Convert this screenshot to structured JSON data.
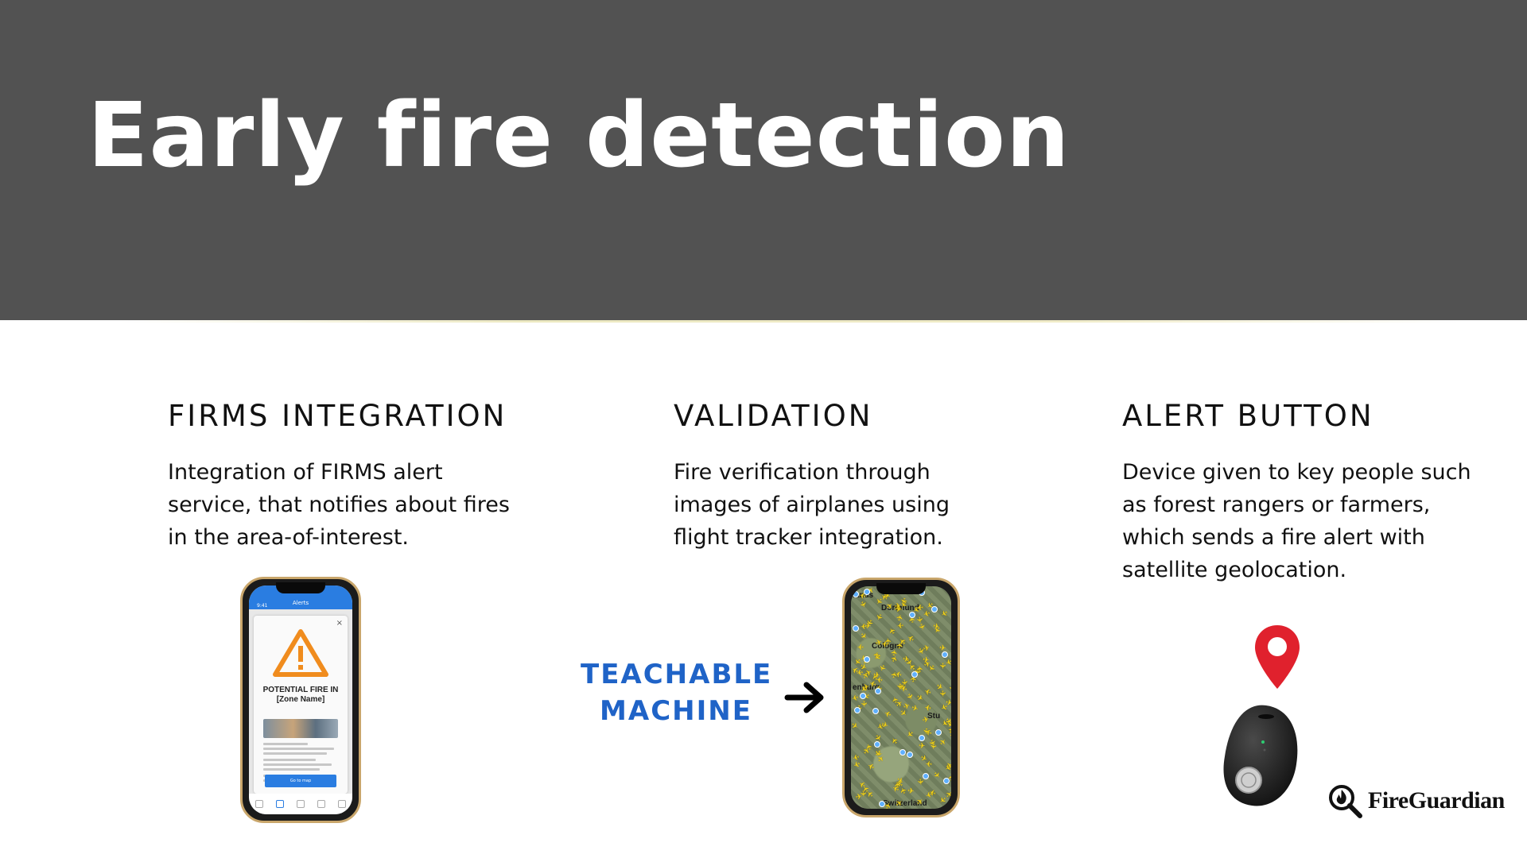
{
  "slide": {
    "title": "Early fire detection"
  },
  "columns": [
    {
      "heading": "FIRMS INTEGRATION",
      "lines": [
        "Integration of FIRMS alert",
        "service, that notifies about fires",
        "in the area-of-interest."
      ]
    },
    {
      "heading": "VALIDATION",
      "lines": [
        "Fire verification through",
        "images of airplanes using",
        "flight tracker integration."
      ]
    },
    {
      "heading": "ALERT BUTTON",
      "lines": [
        "Device given to key people such",
        "as forest rangers or farmers,",
        "which sends a fire alert with",
        "satellite geolocation."
      ]
    }
  ],
  "phone_app": {
    "time": "9:41",
    "bar_title": "Alerts",
    "close_glyph": "×",
    "modal_title_line1": "POTENTIAL FIRE IN",
    "modal_title_line2": "[Zone Name]",
    "button_label": "Go to map"
  },
  "phone_map": {
    "labels": [
      "lands",
      "Dortmund",
      "Cologne",
      "enburg",
      "Stu",
      "Switzerland"
    ]
  },
  "teachable": {
    "line1": "TEACHABLE",
    "line2": "MACHINE"
  },
  "logo": {
    "text": "FireGuardian"
  },
  "colors": {
    "header_bg": "#525252",
    "accent_blue": "#1f63c7",
    "pin_red": "#e0212d",
    "warning_orange": "#f08c1e"
  }
}
